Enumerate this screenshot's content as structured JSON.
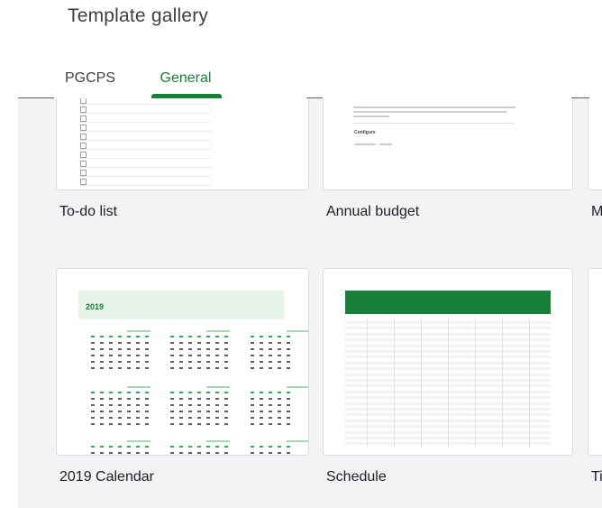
{
  "header": {
    "title": "Template gallery"
  },
  "tabs": [
    {
      "label": "PGCPS",
      "active": false
    },
    {
      "label": "General",
      "active": true
    }
  ],
  "colors": {
    "accent": "#188038",
    "gallery_bg": "#f1f3f4"
  },
  "templates": [
    {
      "label": "To-do list"
    },
    {
      "label": "Annual budget"
    },
    {
      "label": "M"
    },
    {
      "label": "2019 Calendar",
      "thumb_title": "2019"
    },
    {
      "label": "Schedule"
    },
    {
      "label": "Ti"
    }
  ],
  "budget_thumb": {
    "heading": "Configure"
  }
}
